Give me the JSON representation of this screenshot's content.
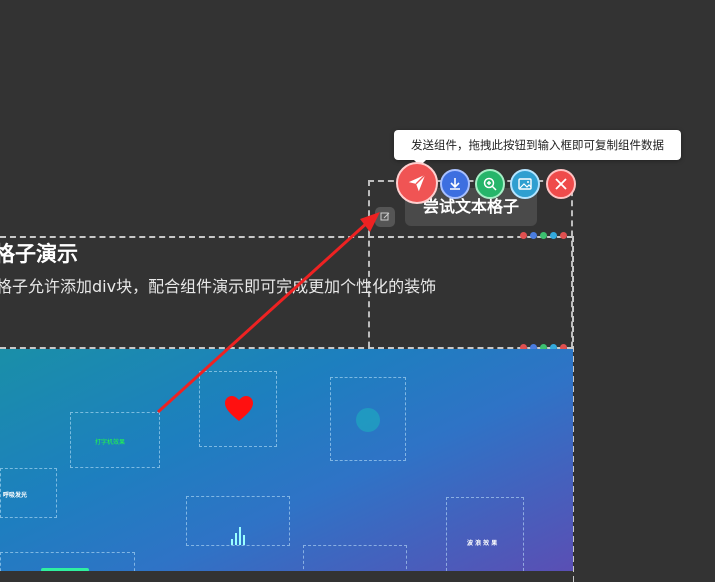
{
  "tooltip": {
    "text": "发送组件，拖拽此按钮到输入框即可复制组件数据"
  },
  "widget": {
    "label": "尝试文本格子"
  },
  "toolbar": {
    "buttons": [
      {
        "name": "send",
        "icon": "paper-plane-icon",
        "color": "#f05454"
      },
      {
        "name": "download",
        "icon": "download-icon",
        "color": "#3d6fe0"
      },
      {
        "name": "zoom",
        "icon": "zoom-in-icon",
        "color": "#26b56a"
      },
      {
        "name": "image",
        "icon": "image-icon",
        "color": "#2f9fd0"
      },
      {
        "name": "close",
        "icon": "close-icon",
        "color": "#ef4b4b"
      }
    ]
  },
  "section": {
    "title": "格子演示",
    "description": "格子允许添加div块，配合组件演示即可完成更加个性化的装饰"
  },
  "panel": {
    "cells": [
      {
        "text": "打字机效果",
        "color": "#22ff44"
      },
      {
        "text": "呼吸发光",
        "color": "#ffffff"
      },
      {
        "text": "波 浪 效 果",
        "color": "#ffffff"
      }
    ]
  },
  "handle_colors": [
    "#e05050",
    "#4a7de0",
    "#3cc070",
    "#33aadd"
  ]
}
